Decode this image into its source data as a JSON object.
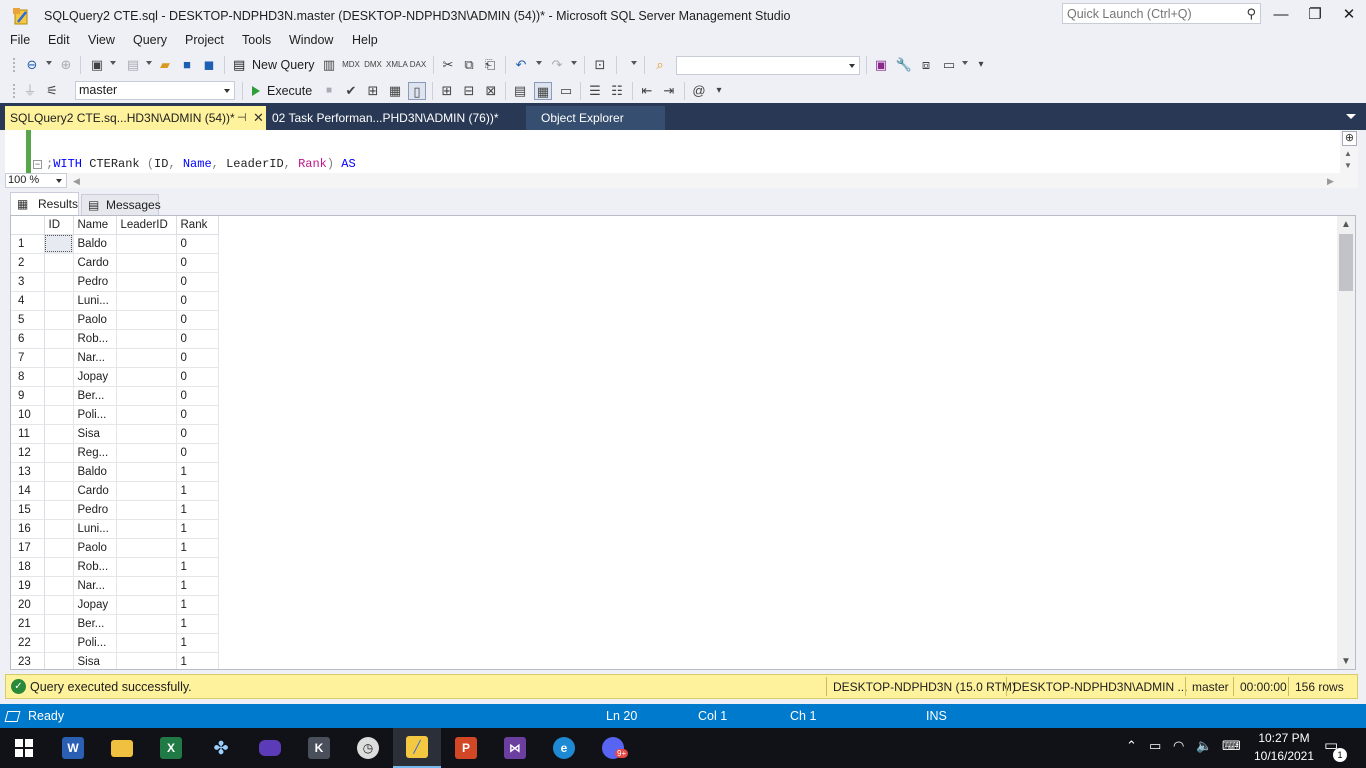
{
  "window": {
    "title": "SQLQuery2 CTE.sql - DESKTOP-NDPHD3N.master (DESKTOP-NDPHD3N\\ADMIN (54))* - Microsoft SQL Server Management Studio",
    "quick_launch_placeholder": "Quick Launch (Ctrl+Q)",
    "buttons": {
      "minimize": "—",
      "restore": "❐",
      "close": "✕"
    }
  },
  "menu": [
    "File",
    "Edit",
    "View",
    "Query",
    "Project",
    "Tools",
    "Window",
    "Help"
  ],
  "toolbar": {
    "new_query_label": "New Query",
    "execute_label": "Execute",
    "database_selected": "master"
  },
  "doc_tabs": {
    "active": "SQLQuery2 CTE.sq...HD3N\\ADMIN (54))*",
    "inactive": "02 Task Performan...PHD3N\\ADMIN (76))*",
    "explorer": "Object Explorer"
  },
  "editor": {
    "code": {
      "prefix": ";",
      "with": "WITH",
      "cte": " CTERank ",
      "open": "(",
      "col1": "ID",
      "comma1": ", ",
      "col2": "Name",
      "comma2": ", ",
      "col3": "LeaderID",
      "comma3": ", ",
      "col4": "Rank",
      "close": ")",
      "as": " AS"
    },
    "zoom": "100 %"
  },
  "results": {
    "tab_results": "Results",
    "tab_messages": "Messages",
    "columns": [
      "ID",
      "Name",
      "LeaderID",
      "Rank"
    ],
    "rows": [
      {
        "n": "1",
        "id": "",
        "name": "Baldo",
        "leader": "",
        "rank": "0"
      },
      {
        "n": "2",
        "id": "",
        "name": "Cardo",
        "leader": "",
        "rank": "0"
      },
      {
        "n": "3",
        "id": "",
        "name": "Pedro",
        "leader": "",
        "rank": "0"
      },
      {
        "n": "4",
        "id": "",
        "name": "Luni...",
        "leader": "",
        "rank": "0"
      },
      {
        "n": "5",
        "id": "",
        "name": "Paolo",
        "leader": "",
        "rank": "0"
      },
      {
        "n": "6",
        "id": "",
        "name": "Rob...",
        "leader": "",
        "rank": "0"
      },
      {
        "n": "7",
        "id": "",
        "name": "Nar...",
        "leader": "",
        "rank": "0"
      },
      {
        "n": "8",
        "id": "",
        "name": "Jopay",
        "leader": "",
        "rank": "0"
      },
      {
        "n": "9",
        "id": "",
        "name": "Ber...",
        "leader": "",
        "rank": "0"
      },
      {
        "n": "10",
        "id": "",
        "name": "Poli...",
        "leader": "",
        "rank": "0"
      },
      {
        "n": "11",
        "id": "",
        "name": "Sisa",
        "leader": "",
        "rank": "0"
      },
      {
        "n": "12",
        "id": "",
        "name": "Reg...",
        "leader": "",
        "rank": "0"
      },
      {
        "n": "13",
        "id": "",
        "name": "Baldo",
        "leader": "",
        "rank": "1"
      },
      {
        "n": "14",
        "id": "",
        "name": "Cardo",
        "leader": "",
        "rank": "1"
      },
      {
        "n": "15",
        "id": "",
        "name": "Pedro",
        "leader": "",
        "rank": "1"
      },
      {
        "n": "16",
        "id": "",
        "name": "Luni...",
        "leader": "",
        "rank": "1"
      },
      {
        "n": "17",
        "id": "",
        "name": "Paolo",
        "leader": "",
        "rank": "1"
      },
      {
        "n": "18",
        "id": "",
        "name": "Rob...",
        "leader": "",
        "rank": "1"
      },
      {
        "n": "19",
        "id": "",
        "name": "Nar...",
        "leader": "",
        "rank": "1"
      },
      {
        "n": "20",
        "id": "",
        "name": "Jopay",
        "leader": "",
        "rank": "1"
      },
      {
        "n": "21",
        "id": "",
        "name": "Ber...",
        "leader": "",
        "rank": "1"
      },
      {
        "n": "22",
        "id": "",
        "name": "Poli...",
        "leader": "",
        "rank": "1"
      },
      {
        "n": "23",
        "id": "",
        "name": "Sisa",
        "leader": "",
        "rank": "1"
      }
    ]
  },
  "query_status": {
    "message": "Query executed successfully.",
    "server": "DESKTOP-NDPHD3N (15.0 RTM)",
    "user": "DESKTOP-NDPHD3N\\ADMIN ...",
    "database": "master",
    "elapsed": "00:00:00",
    "row_count": "156 rows"
  },
  "status_bar": {
    "state": "Ready",
    "line": "Ln 20",
    "col": "Col 1",
    "ch": "Ch 1",
    "mode": "INS"
  },
  "taskbar": {
    "apps": [
      "windows-start",
      "word",
      "file-explorer",
      "excel",
      "game-controller",
      "media-app",
      "k-app",
      "clock-app",
      "ssms",
      "powerpoint",
      "visual-studio",
      "edge",
      "discord"
    ],
    "time": "10:27 PM",
    "date": "10/16/2021",
    "notifications": "1",
    "discord_badge": "9+"
  }
}
